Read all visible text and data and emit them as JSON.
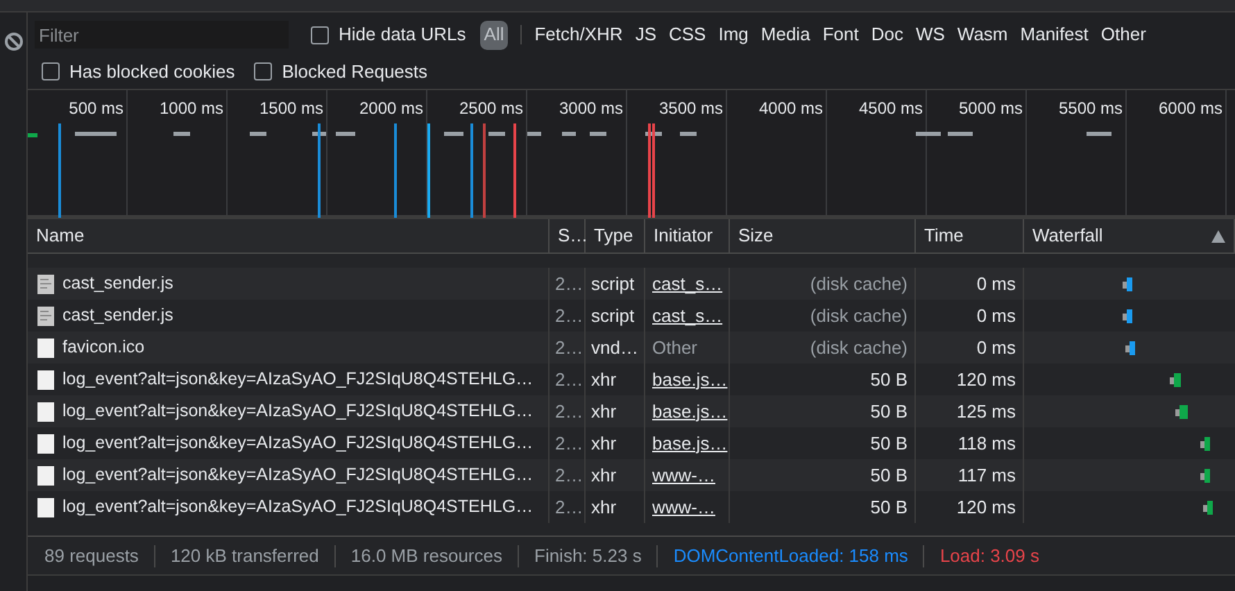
{
  "filter": {
    "placeholder": "Filter"
  },
  "hide_data_urls": {
    "label": "Hide data URLs",
    "checked": false
  },
  "type_filters": [
    {
      "label": "All",
      "selected": true
    },
    {
      "label": "Fetch/XHR",
      "selected": false
    },
    {
      "label": "JS",
      "selected": false
    },
    {
      "label": "CSS",
      "selected": false
    },
    {
      "label": "Img",
      "selected": false
    },
    {
      "label": "Media",
      "selected": false
    },
    {
      "label": "Font",
      "selected": false
    },
    {
      "label": "Doc",
      "selected": false
    },
    {
      "label": "WS",
      "selected": false
    },
    {
      "label": "Wasm",
      "selected": false
    },
    {
      "label": "Manifest",
      "selected": false
    },
    {
      "label": "Other",
      "selected": false
    }
  ],
  "options": [
    {
      "label": "Has blocked cookies",
      "checked": false
    },
    {
      "label": "Blocked Requests",
      "checked": false
    }
  ],
  "timeline": {
    "ticks": [
      "500 ms",
      "1000 ms",
      "1500 ms",
      "2000 ms",
      "2500 ms",
      "3000 ms",
      "3500 ms",
      "4000 ms",
      "4500 ms",
      "5000 ms",
      "5500 ms",
      "6000 ms"
    ]
  },
  "table": {
    "columns": [
      "Name",
      "S…",
      "Type",
      "Initiator",
      "Size",
      "Time",
      "Waterfall"
    ],
    "rows": [
      {
        "name": "cast_sender.js",
        "kind": "script",
        "status": "2…",
        "type": "script",
        "initiator": "cast_s…",
        "initiator_link": true,
        "size": "(disk cache)",
        "time": "0 ms"
      },
      {
        "name": "cast_sender.js",
        "kind": "script",
        "status": "2…",
        "type": "script",
        "initiator": "cast_s…",
        "initiator_link": true,
        "size": "(disk cache)",
        "time": "0 ms"
      },
      {
        "name": "favicon.ico",
        "kind": "doc",
        "status": "2…",
        "type": "vnd…",
        "initiator": "Other",
        "initiator_link": false,
        "size": "(disk cache)",
        "time": "0 ms"
      },
      {
        "name": "log_event?alt=json&key=AIzaSyAO_FJ2SIqU8Q4STEHLG…",
        "kind": "doc",
        "status": "2…",
        "type": "xhr",
        "initiator": "base.js…",
        "initiator_link": true,
        "size": "50 B",
        "time": "120 ms"
      },
      {
        "name": "log_event?alt=json&key=AIzaSyAO_FJ2SIqU8Q4STEHLG…",
        "kind": "doc",
        "status": "2…",
        "type": "xhr",
        "initiator": "base.js…",
        "initiator_link": true,
        "size": "50 B",
        "time": "125 ms"
      },
      {
        "name": "log_event?alt=json&key=AIzaSyAO_FJ2SIqU8Q4STEHLG…",
        "kind": "doc",
        "status": "2…",
        "type": "xhr",
        "initiator": "base.js…",
        "initiator_link": true,
        "size": "50 B",
        "time": "118 ms"
      },
      {
        "name": "log_event?alt=json&key=AIzaSyAO_FJ2SIqU8Q4STEHLG…",
        "kind": "doc",
        "status": "2…",
        "type": "xhr",
        "initiator": "www-…",
        "initiator_link": true,
        "size": "50 B",
        "time": "117 ms"
      },
      {
        "name": "log_event?alt=json&key=AIzaSyAO_FJ2SIqU8Q4STEHLG…",
        "kind": "doc",
        "status": "2…",
        "type": "xhr",
        "initiator": "www-…",
        "initiator_link": true,
        "size": "50 B",
        "time": "120 ms"
      }
    ]
  },
  "status_bar": [
    {
      "text": "89 requests",
      "kind": "plain"
    },
    {
      "text": "120 kB transferred",
      "kind": "plain"
    },
    {
      "text": "16.0 MB resources",
      "kind": "plain"
    },
    {
      "text": "Finish: 5.23 s",
      "kind": "plain"
    },
    {
      "text": "DOMContentLoaded: 158 ms",
      "kind": "dom"
    },
    {
      "text": "Load: 3.09 s",
      "kind": "load"
    }
  ]
}
